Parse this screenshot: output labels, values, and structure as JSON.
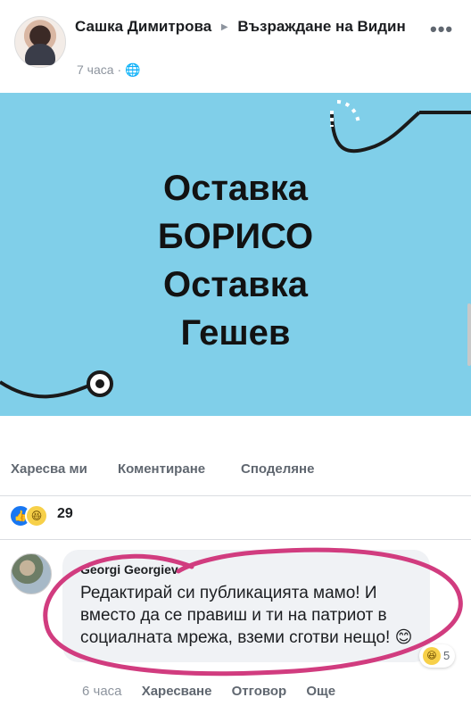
{
  "post": {
    "author": "Сашка Димитрова",
    "group": "Възраждане на Видин",
    "time": "7 часа",
    "privacy_icon": "globe-icon",
    "more_icon": "more-dots-icon"
  },
  "banner": {
    "lines": [
      "Оставка",
      "БОРИСО",
      "Оставка",
      "Гешев"
    ],
    "background": "#80cfe9"
  },
  "actions": {
    "like": "Харесва ми",
    "comment": "Коментиране",
    "share": "Споделяне"
  },
  "reactions": {
    "count": "29",
    "types": [
      "like-icon",
      "haha-icon"
    ]
  },
  "comment": {
    "author": "Georgi Georgiev",
    "text": "Редактирай си публикацията мамо! И вместо да се правиш и ти на патриот в социалната мрежа, вземи сготви нещо! 😊",
    "reaction_count": "5",
    "time": "6 часа",
    "like": "Харесване",
    "reply": "Отговор",
    "more": "Още"
  },
  "colors": {
    "highlight": "#d13c7f",
    "accent": "#1877f2"
  }
}
